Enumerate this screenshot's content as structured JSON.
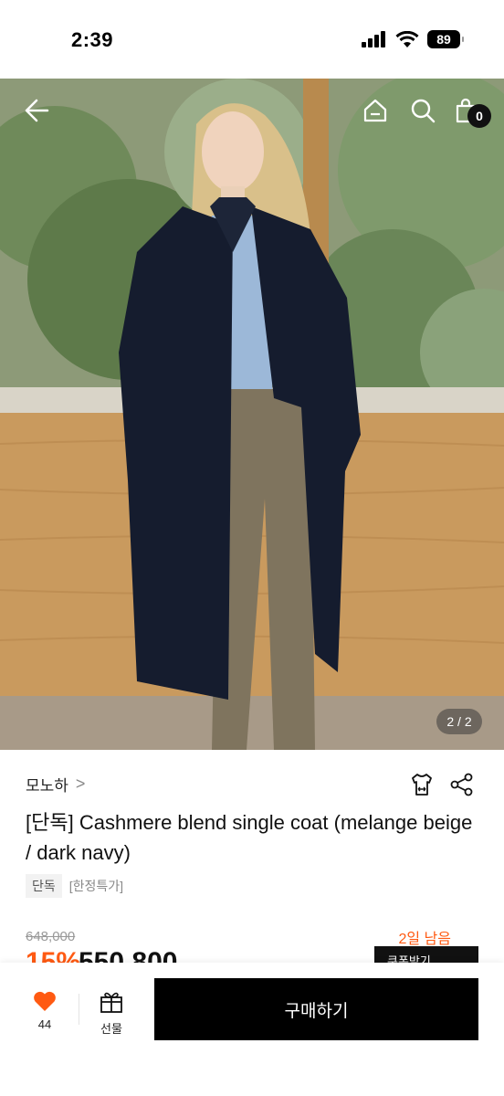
{
  "status_bar": {
    "time": "2:39",
    "battery": "89"
  },
  "hero": {
    "page_indicator": "2 / 2",
    "cart_count": "0",
    "icons": [
      "back-arrow-icon",
      "home-icon",
      "search-icon",
      "shopping-bag-icon"
    ]
  },
  "product": {
    "brand": "모노하",
    "brand_chevron": ">",
    "title": "[단독] Cashmere blend single coat (melange beige / dark navy)",
    "tags": [
      "단독",
      "[한정특가]"
    ],
    "original_price": "648,000",
    "days_left": "2일 남음",
    "discount": "15%",
    "sale_price": "550,800",
    "coupon_label": "쿠폰받기"
  },
  "bottom_bar": {
    "like_count": "44",
    "gift_label": "선물",
    "buy_label": "구매하기"
  },
  "colors": {
    "accent": "#ff5a12",
    "primary": "#000000"
  }
}
